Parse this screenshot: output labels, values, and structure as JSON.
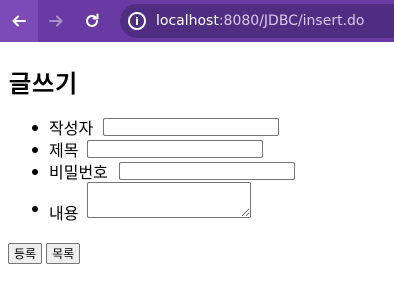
{
  "browser": {
    "url_host": "localhost",
    "url_path": ":8080/JDBC/insert.do"
  },
  "page": {
    "title": "글쓰기",
    "fields": [
      {
        "label": "작성자",
        "value": ""
      },
      {
        "label": "제목",
        "value": ""
      },
      {
        "label": "비밀번호",
        "value": ""
      },
      {
        "label": "내용",
        "value": ""
      }
    ],
    "buttons": {
      "submit": "등록",
      "list": "목록"
    }
  }
}
